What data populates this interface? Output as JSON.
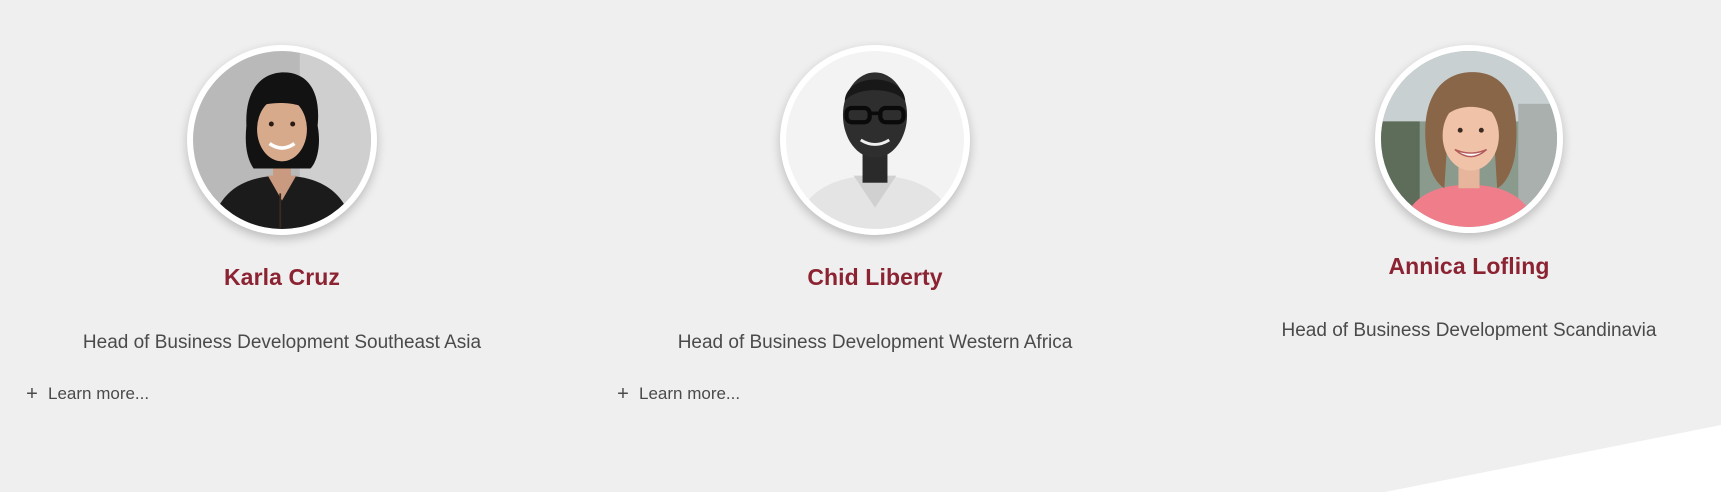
{
  "team": [
    {
      "name": "Karla Cruz",
      "role": "Head of Business Development Southeast Asia",
      "learn_more": "Learn more...",
      "learn_more_icon": "plus-icon",
      "photo": "karla-cruz-portrait"
    },
    {
      "name": "Chid Liberty",
      "role": "Head of Business Development Western Africa",
      "learn_more": "Learn more...",
      "learn_more_icon": "plus-icon",
      "photo": "chid-liberty-portrait"
    },
    {
      "name": "Annica Lofling",
      "role": "Head of Business Development Scandinavia",
      "photo": "annica-lofling-portrait"
    }
  ],
  "colors": {
    "background": "#efefef",
    "name": "#8b2332",
    "text": "#4a4a4a"
  }
}
